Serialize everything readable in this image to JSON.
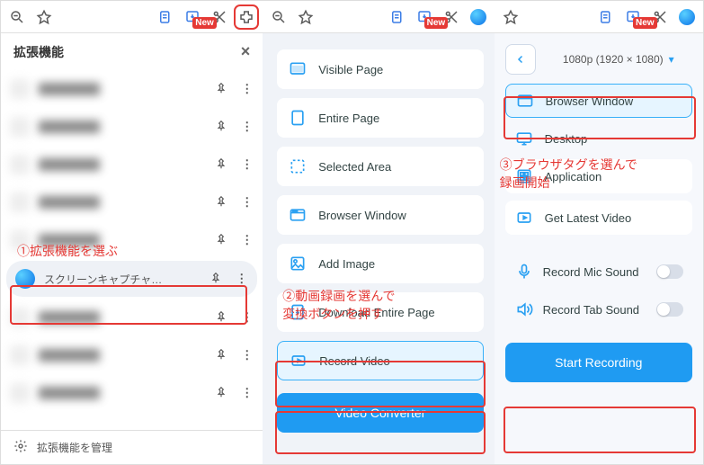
{
  "panel1": {
    "title": "拡張機能",
    "selected_ext": "スクリーンキャプチャ…",
    "manage": "拡張機能を管理",
    "annotation": "①拡張機能を選ぶ"
  },
  "panel2": {
    "items": [
      {
        "label": "Visible Page"
      },
      {
        "label": "Entire Page"
      },
      {
        "label": "Selected Area"
      },
      {
        "label": "Browser Window"
      },
      {
        "label": "Add Image"
      },
      {
        "label": "Download Entire Page"
      },
      {
        "label": "Record Video"
      }
    ],
    "primary_button": "Video Converter",
    "annotation": "②動画録画を選んで\n変換ボタンを押す"
  },
  "panel3": {
    "resolution": "1080p (1920 × 1080)",
    "items": [
      {
        "label": "Browser Window"
      },
      {
        "label": "Desktop"
      },
      {
        "label": "Application"
      },
      {
        "label": "Get Latest Video"
      }
    ],
    "toggles": [
      {
        "label": "Record Mic Sound"
      },
      {
        "label": "Record Tab Sound"
      }
    ],
    "primary_button": "Start Recording",
    "annotation": "③ブラウザタグを選んで\n録画開始"
  },
  "toolbar_badge": "New"
}
